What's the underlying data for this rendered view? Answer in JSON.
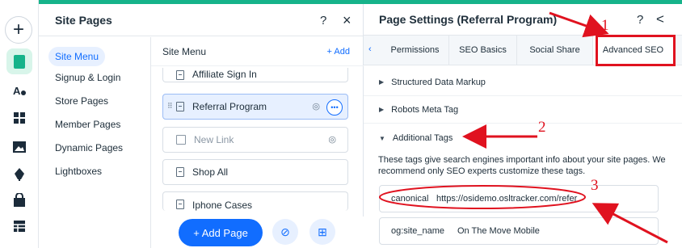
{
  "rail": {
    "icons": [
      "plus-icon",
      "pages-icon",
      "design-icon",
      "apps-icon",
      "media-icon",
      "blog-icon",
      "store-icon",
      "business-icon"
    ]
  },
  "site_pages": {
    "title": "Site Pages",
    "help": "?",
    "close": "×",
    "categories": [
      "Site Menu",
      "Signup & Login",
      "Store Pages",
      "Member Pages",
      "Dynamic Pages",
      "Lightboxes"
    ],
    "menu_header": "Site Menu",
    "add_label": "+ Add",
    "pages": [
      "Affiliate Sign In",
      "Referral Program",
      "New Link",
      "Shop All",
      "Iphone Cases"
    ],
    "add_page_button": "+ Add Page"
  },
  "page_settings": {
    "title": "Page Settings (Referral Program)",
    "help": "?",
    "back": "<",
    "tabs": [
      "Permissions",
      "SEO Basics",
      "Social Share",
      "Advanced SEO"
    ],
    "sections": [
      "Structured Data Markup",
      "Robots Meta Tag",
      "Additional Tags"
    ],
    "description": "These tags give search engines important info about your site pages. We recommend only SEO experts customize these tags.",
    "tags": [
      {
        "key": "canonical",
        "value": "https://osidemo.osltracker.com/refer"
      },
      {
        "key": "og:site_name",
        "value": "On The Move Mobile"
      }
    ]
  },
  "annotations": {
    "numbers": [
      "1",
      "2",
      "3"
    ],
    "color": "#e0121f"
  }
}
